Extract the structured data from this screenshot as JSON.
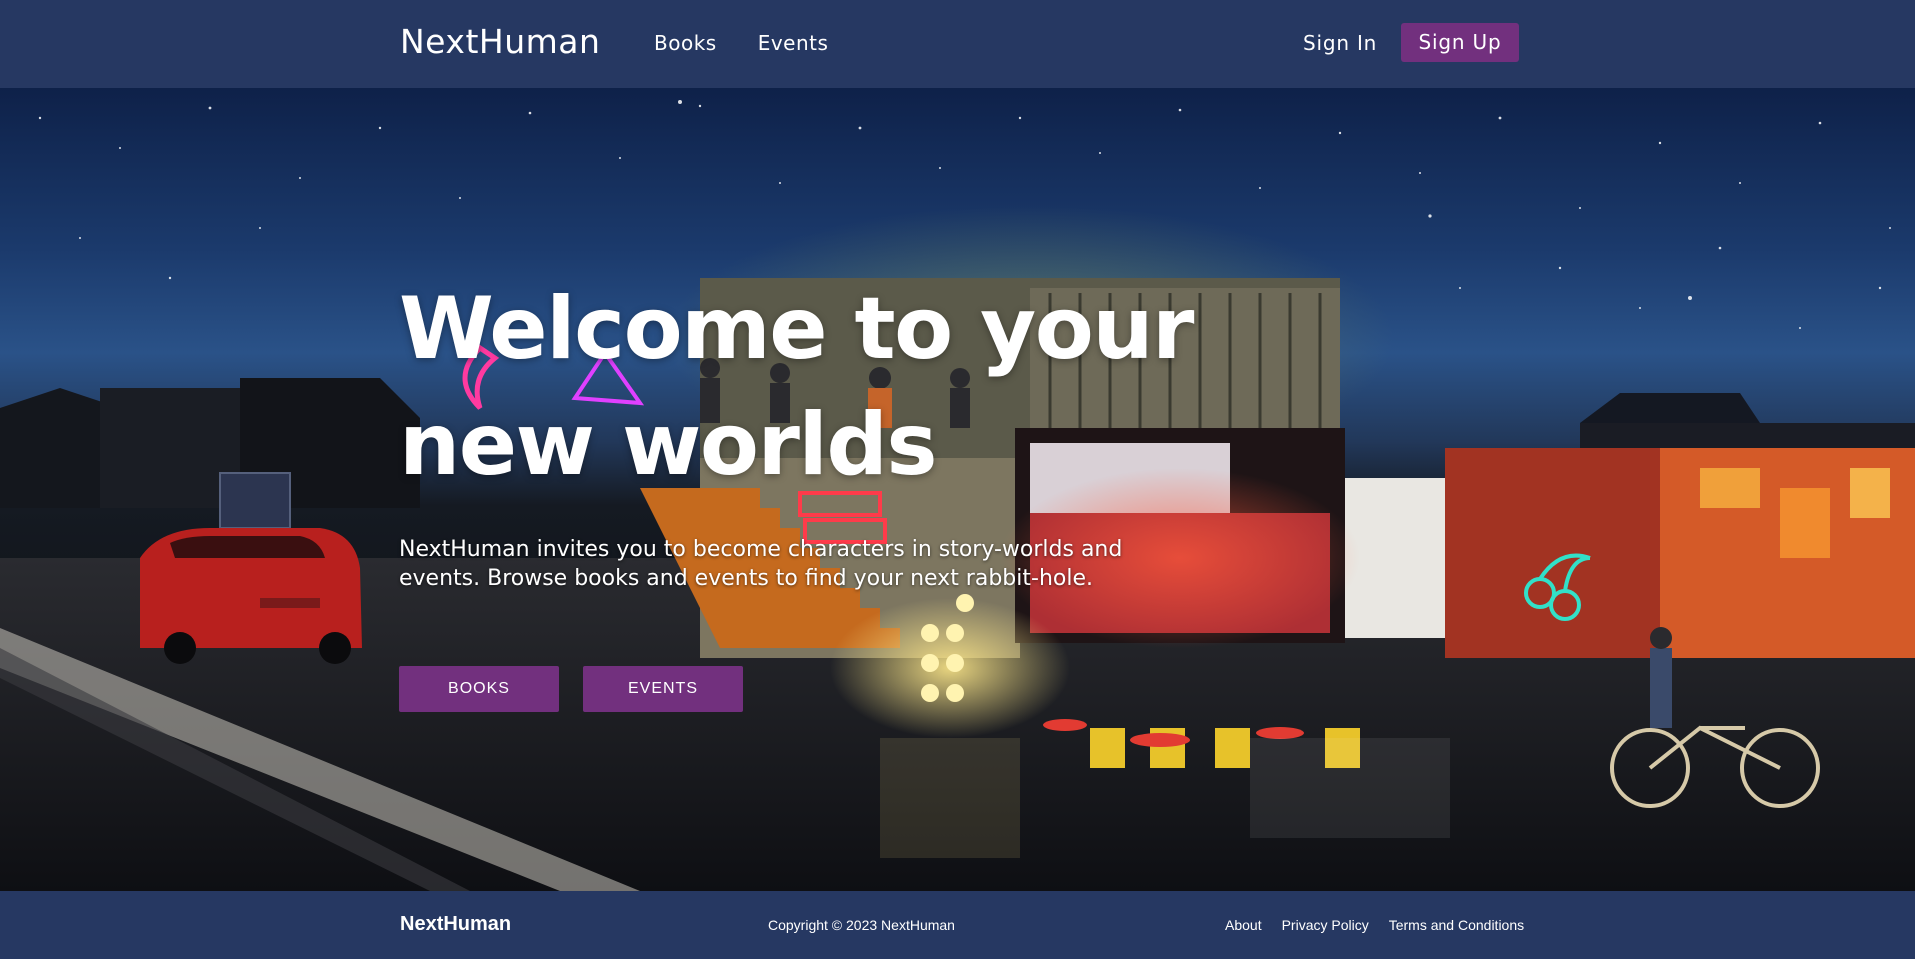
{
  "nav": {
    "logo": "NextHuman",
    "links": [
      "Books",
      "Events"
    ],
    "sign_in": "Sign In",
    "sign_up": "Sign Up"
  },
  "hero": {
    "title": "Welcome to your new worlds",
    "subtitle": "NextHuman invites you to become characters in story-worlds and events. Browse books and events to find your next rabbit-hole.",
    "buttons": [
      "BOOKS",
      "EVENTS"
    ]
  },
  "footer": {
    "logo": "NextHuman",
    "copyright": "Copyright © 2023 NextHuman",
    "links": [
      "About",
      "Privacy Policy",
      "Terms and Conditions"
    ]
  },
  "colors": {
    "nav_bg": "#263862",
    "accent": "#72307e",
    "text": "#ffffff"
  }
}
